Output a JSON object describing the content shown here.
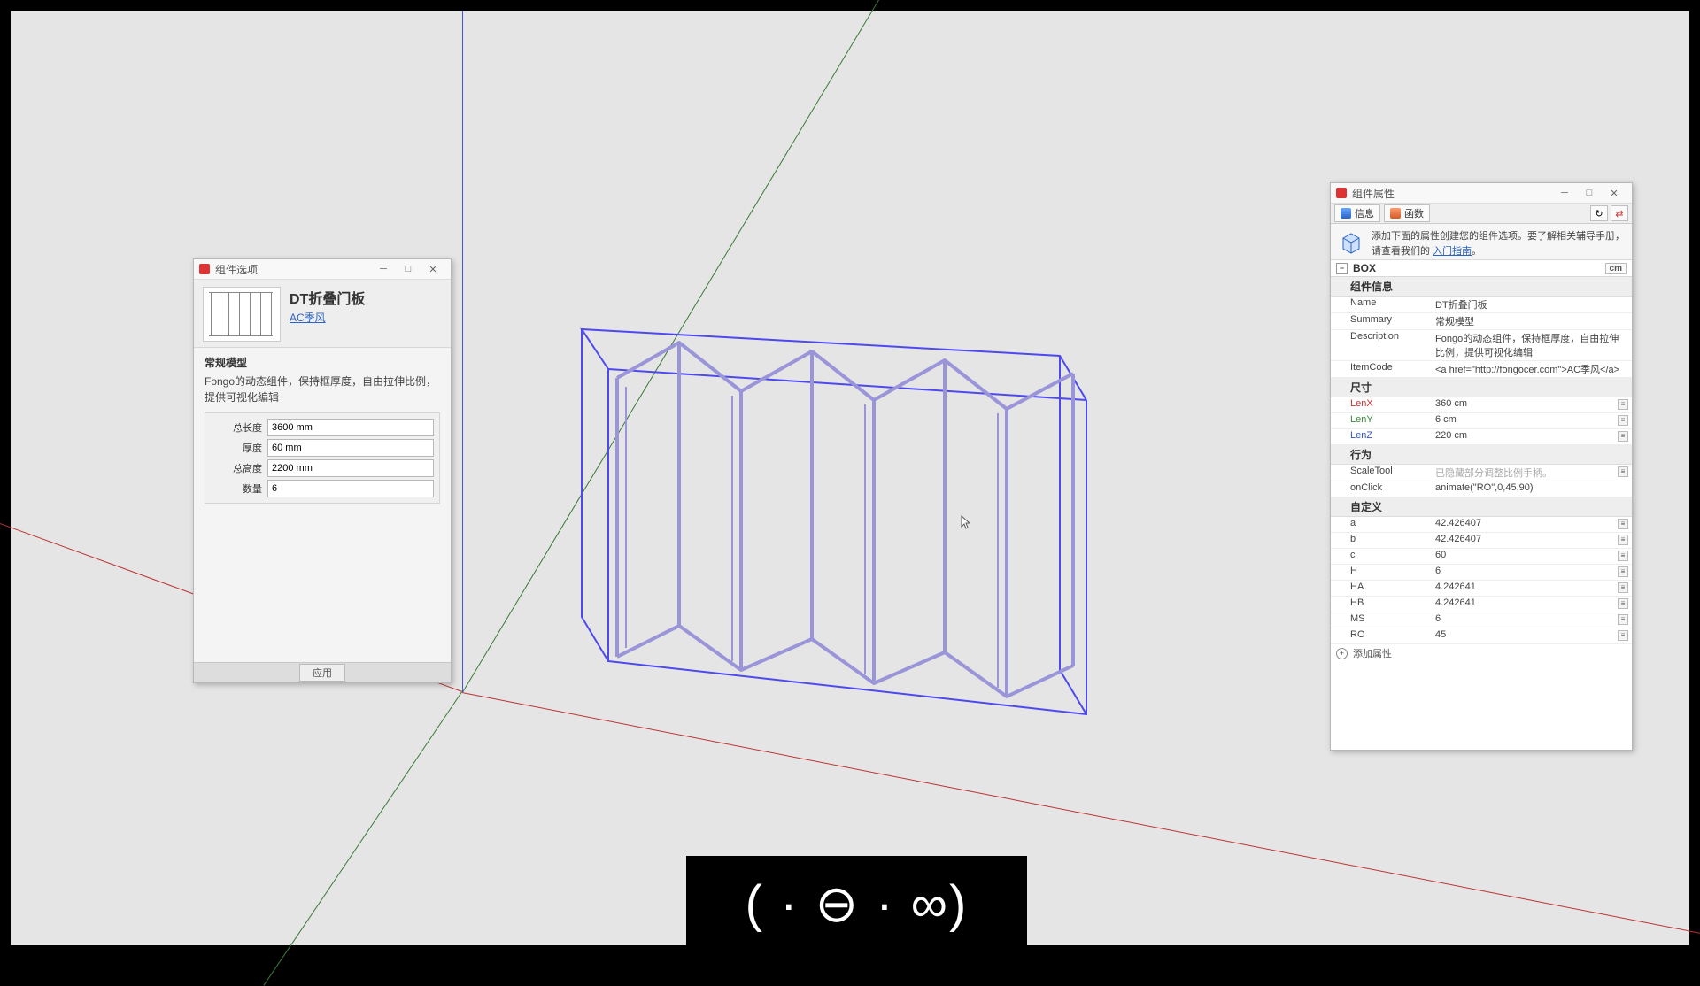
{
  "leftPanel": {
    "winTitle": "组件选项",
    "title": "DT折叠门板",
    "author": "AC季风",
    "sectionTitle": "常规模型",
    "description": "Fongo的动态组件，保持框厚度，自由拉伸比例，提供可视化编辑",
    "fields": {
      "totalLength": {
        "label": "总长度",
        "value": "3600 mm"
      },
      "thickness": {
        "label": "厚度",
        "value": "60 mm"
      },
      "totalHeight": {
        "label": "总高度",
        "value": "2200 mm"
      },
      "count": {
        "label": "数量",
        "value": "6"
      }
    },
    "applyLabel": "应用"
  },
  "rightPanel": {
    "winTitle": "组件属性",
    "tabs": {
      "info": "信息",
      "func": "函数"
    },
    "bannerText": "添加下面的属性创建您的组件选项。要了解相关辅导手册，请查看我们的",
    "bannerLink": "入门指南",
    "bannerTail": "。",
    "group": "BOX",
    "unit": "cm",
    "sections": {
      "compInfo": {
        "title": "组件信息",
        "rows": {
          "Name": "DT折叠门板",
          "Summary": "常规模型",
          "Description": "Fongo的动态组件，保持框厚度，自由拉伸比例，提供可视化编辑",
          "ItemCode": "<a href=\"http://fongocer.com\">AC季风</a>"
        }
      },
      "size": {
        "title": "尺寸",
        "rows": {
          "LenX": "360 cm",
          "LenY": "6 cm",
          "LenZ": "220 cm"
        }
      },
      "behavior": {
        "title": "行为",
        "rows": {
          "ScaleTool": "已隐藏部分调整比例手柄。",
          "onClick": "animate(\"RO\",0,45,90)"
        }
      },
      "custom": {
        "title": "自定义",
        "rows": {
          "a": "42.426407",
          "b": "42.426407",
          "c": "60",
          "H": "6",
          "HA": "4.242641",
          "HB": "4.242641",
          "MS": "6",
          "RO": "45"
        }
      }
    },
    "addAttr": "添加属性"
  },
  "watermark": "( · ⊖ · ∞)"
}
